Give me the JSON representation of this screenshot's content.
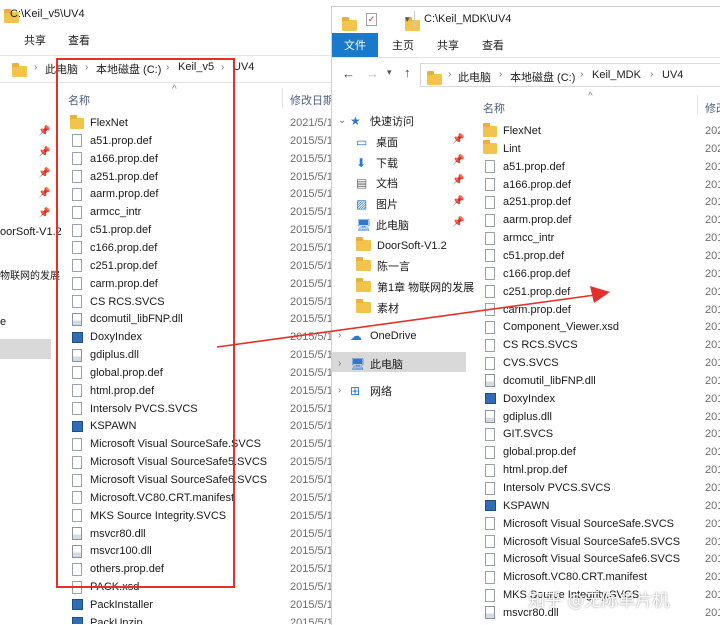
{
  "left_window": {
    "title": "C:\\Keil_v5\\UV4",
    "ribbon_tabs": [
      "共享",
      "查看"
    ],
    "breadcrumb": [
      "此电脑",
      "本地磁盘 (C:)",
      "Keil_v5",
      "UV4"
    ],
    "col_name": "名称",
    "col_date": "修改日期",
    "nav_items": [
      "oorSoft-V1.2",
      "物联网的发展",
      "e"
    ],
    "files": [
      {
        "name": "FlexNet",
        "icon": "folder",
        "date": "2021/5/1"
      },
      {
        "name": "a51.prop.def",
        "icon": "file",
        "date": "2015/5/1"
      },
      {
        "name": "a166.prop.def",
        "icon": "file",
        "date": "2015/5/1"
      },
      {
        "name": "a251.prop.def",
        "icon": "file",
        "date": "2015/5/1"
      },
      {
        "name": "aarm.prop.def",
        "icon": "file",
        "date": "2015/5/1"
      },
      {
        "name": "armcc_intr",
        "icon": "file",
        "date": "2015/5/1"
      },
      {
        "name": "c51.prop.def",
        "icon": "file",
        "date": "2015/5/1"
      },
      {
        "name": "c166.prop.def",
        "icon": "file",
        "date": "2015/5/1"
      },
      {
        "name": "c251.prop.def",
        "icon": "file",
        "date": "2015/5/1"
      },
      {
        "name": "carm.prop.def",
        "icon": "file",
        "date": "2015/5/1"
      },
      {
        "name": "CS RCS.SVCS",
        "icon": "file",
        "date": "2015/5/1"
      },
      {
        "name": "dcomutil_libFNP.dll",
        "icon": "dll",
        "date": "2015/5/1"
      },
      {
        "name": "DoxyIndex",
        "icon": "exe",
        "date": "2015/5/1"
      },
      {
        "name": "gdiplus.dll",
        "icon": "dll",
        "date": "2015/5/1"
      },
      {
        "name": "global.prop.def",
        "icon": "file",
        "date": "2015/5/1"
      },
      {
        "name": "html.prop.def",
        "icon": "file",
        "date": "2015/5/1"
      },
      {
        "name": "Intersolv PVCS.SVCS",
        "icon": "file",
        "date": "2015/5/1"
      },
      {
        "name": "KSPAWN",
        "icon": "exe",
        "date": "2015/5/1"
      },
      {
        "name": "Microsoft Visual SourceSafe.SVCS",
        "icon": "file",
        "date": "2015/5/1"
      },
      {
        "name": "Microsoft Visual SourceSafe5.SVCS",
        "icon": "file",
        "date": "2015/5/1"
      },
      {
        "name": "Microsoft Visual SourceSafe6.SVCS",
        "icon": "file",
        "date": "2015/5/1"
      },
      {
        "name": "Microsoft.VC80.CRT.manifest",
        "icon": "file",
        "date": "2015/5/1"
      },
      {
        "name": "MKS Source Integrity.SVCS",
        "icon": "file",
        "date": "2015/5/1"
      },
      {
        "name": "msvcr80.dll",
        "icon": "dll",
        "date": "2015/5/1"
      },
      {
        "name": "msvcr100.dll",
        "icon": "dll",
        "date": "2015/5/1"
      },
      {
        "name": "others.prop.def",
        "icon": "file",
        "date": "2015/5/1"
      },
      {
        "name": "PACK.xsd",
        "icon": "file",
        "date": "2015/5/1"
      },
      {
        "name": "PackInstaller",
        "icon": "exe",
        "date": "2015/5/1"
      },
      {
        "name": "PackUnzip",
        "icon": "exe",
        "date": "2015/5/1"
      }
    ]
  },
  "right_window": {
    "title": "C:\\Keil_MDK\\UV4",
    "ribbon_tabs": [
      "文件",
      "主页",
      "共享",
      "查看"
    ],
    "breadcrumb": [
      "此电脑",
      "本地磁盘 (C:)",
      "Keil_MDK",
      "UV4"
    ],
    "col_name": "名称",
    "col_date": "修改",
    "nav_items": [
      {
        "label": "快速访问",
        "icon": "star",
        "pinned": false
      },
      {
        "label": "桌面",
        "icon": "desktop",
        "pinned": true
      },
      {
        "label": "下载",
        "icon": "download",
        "pinned": true
      },
      {
        "label": "文档",
        "icon": "document",
        "pinned": true
      },
      {
        "label": "图片",
        "icon": "picture",
        "pinned": true
      },
      {
        "label": "此电脑",
        "icon": "pc",
        "pinned": true
      },
      {
        "label": "DoorSoft-V1.2",
        "icon": "folder",
        "pinned": false
      },
      {
        "label": "陈一言",
        "icon": "folder",
        "pinned": false
      },
      {
        "label": "第1章 物联网的发展",
        "icon": "folder",
        "pinned": false
      },
      {
        "label": "素材",
        "icon": "folder",
        "pinned": false
      },
      {
        "label": "OneDrive",
        "icon": "cloud",
        "pinned": false
      },
      {
        "label": "此电脑",
        "icon": "pc",
        "pinned": false
      },
      {
        "label": "网络",
        "icon": "network",
        "pinned": false
      }
    ],
    "files": [
      {
        "name": "FlexNet",
        "icon": "folder",
        "date": "202"
      },
      {
        "name": "Lint",
        "icon": "folder",
        "date": "202"
      },
      {
        "name": "a51.prop.def",
        "icon": "file",
        "date": "201"
      },
      {
        "name": "a166.prop.def",
        "icon": "file",
        "date": "201"
      },
      {
        "name": "a251.prop.def",
        "icon": "file",
        "date": "201"
      },
      {
        "name": "aarm.prop.def",
        "icon": "file",
        "date": "201"
      },
      {
        "name": "armcc_intr",
        "icon": "file",
        "date": "201"
      },
      {
        "name": "c51.prop.def",
        "icon": "file",
        "date": "201"
      },
      {
        "name": "c166.prop.def",
        "icon": "file",
        "date": "201"
      },
      {
        "name": "c251.prop.def",
        "icon": "file",
        "date": "201"
      },
      {
        "name": "carm.prop.def",
        "icon": "file",
        "date": "201"
      },
      {
        "name": "Component_Viewer.xsd",
        "icon": "file",
        "date": "201"
      },
      {
        "name": "CS RCS.SVCS",
        "icon": "file",
        "date": "201"
      },
      {
        "name": "CVS.SVCS",
        "icon": "file",
        "date": "201"
      },
      {
        "name": "dcomutil_libFNP.dll",
        "icon": "dll",
        "date": "201"
      },
      {
        "name": "DoxyIndex",
        "icon": "exe",
        "date": "201"
      },
      {
        "name": "gdiplus.dll",
        "icon": "dll",
        "date": "201"
      },
      {
        "name": "GIT.SVCS",
        "icon": "file",
        "date": "201"
      },
      {
        "name": "global.prop.def",
        "icon": "file",
        "date": "201"
      },
      {
        "name": "html.prop.def",
        "icon": "file",
        "date": "201"
      },
      {
        "name": "Intersolv PVCS.SVCS",
        "icon": "file",
        "date": "201"
      },
      {
        "name": "KSPAWN",
        "icon": "exe",
        "date": "201"
      },
      {
        "name": "Microsoft Visual SourceSafe.SVCS",
        "icon": "file",
        "date": "201"
      },
      {
        "name": "Microsoft Visual SourceSafe5.SVCS",
        "icon": "file",
        "date": "201"
      },
      {
        "name": "Microsoft Visual SourceSafe6.SVCS",
        "icon": "file",
        "date": "201"
      },
      {
        "name": "Microsoft.VC80.CRT.manifest",
        "icon": "file",
        "date": "201"
      },
      {
        "name": "MKS Source Integrity.SVCS",
        "icon": "file",
        "date": "201"
      },
      {
        "name": "msvcr80.dll",
        "icon": "dll",
        "date": "201"
      }
    ]
  },
  "annotation": {
    "box_color": "#e5302a",
    "arrow_color": "#e5302a"
  },
  "watermark": "知乎 @无际单片机",
  "colors": {
    "accent": "#1979ca",
    "selected": "#cce8ff",
    "folder": "#f3c44c"
  }
}
